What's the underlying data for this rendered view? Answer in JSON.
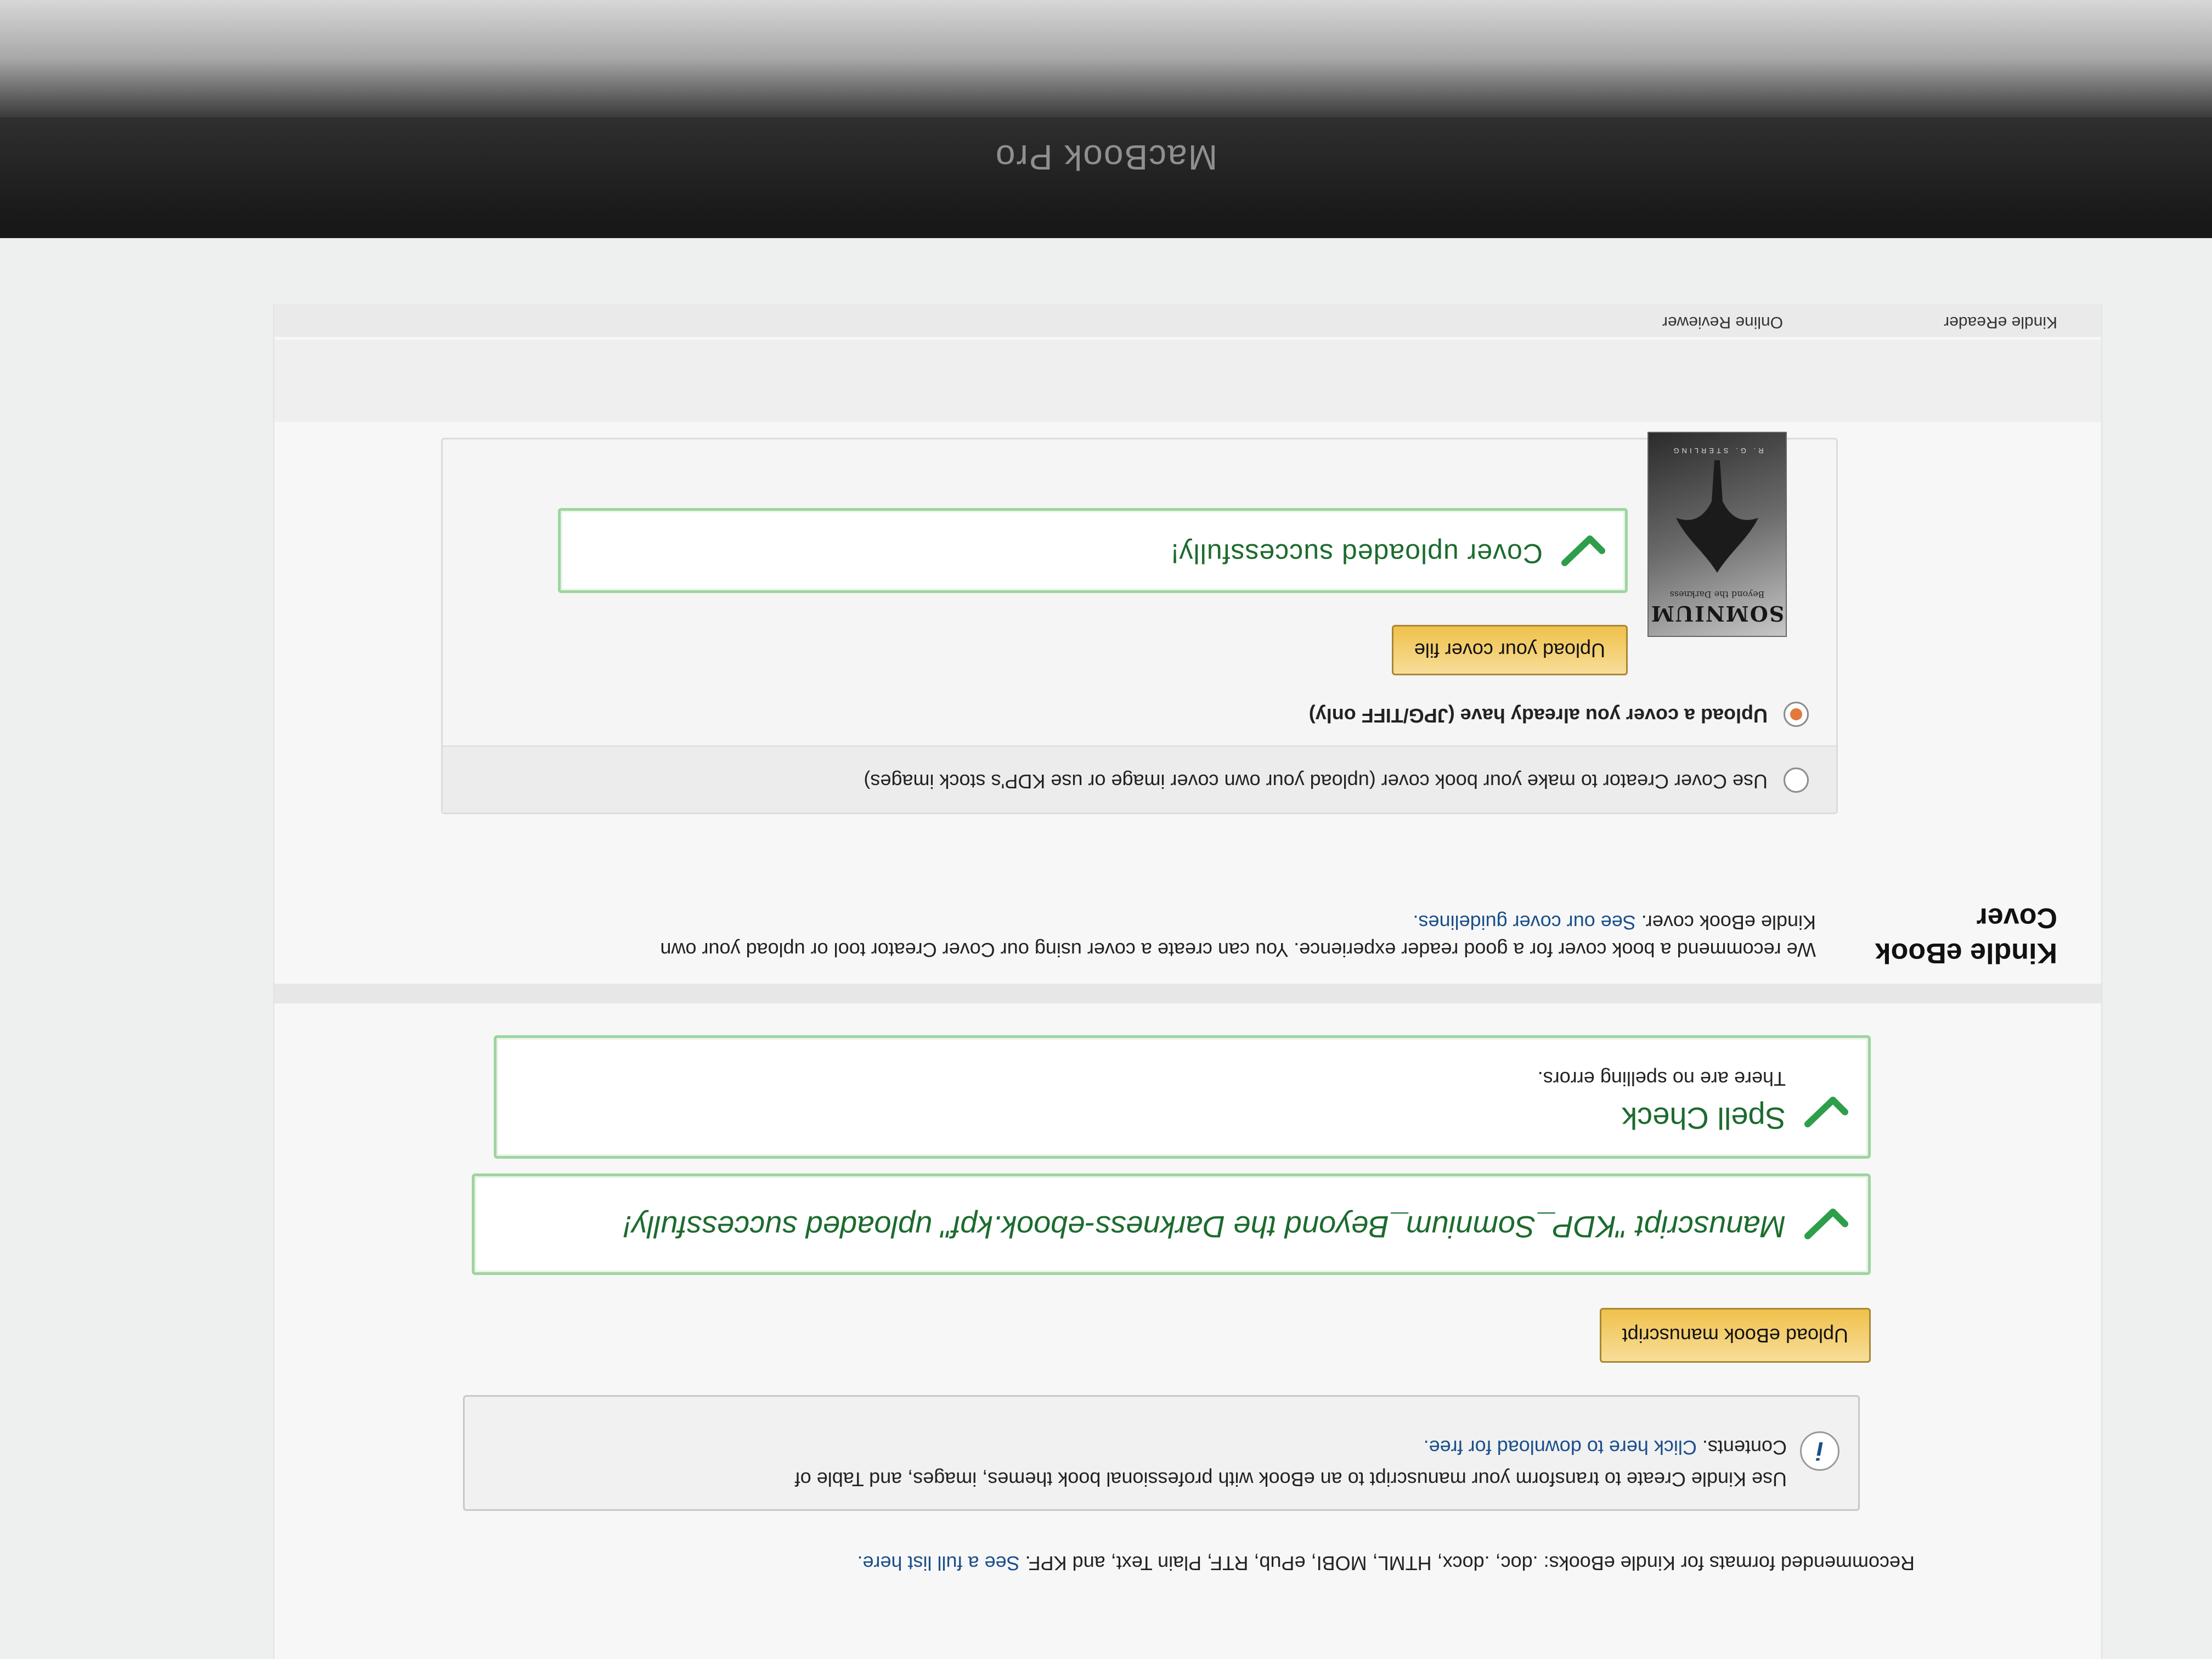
{
  "device": {
    "brand_label": "MacBook Pro"
  },
  "manuscript": {
    "formats_text": "Recommended formats for Kindle eBooks: .doc, .docx, HTML, MOBI, ePub, RTF, Plain Text, and KPF.",
    "formats_link": "See a full list here.",
    "info_icon_glyph": "i",
    "info_line1": "Use Kindle Create to transform your manuscript to an eBook with professional book themes, images, and Table of",
    "info_line2_prefix": "Contents.",
    "info_link": "Click here to download for free.",
    "upload_button_label": "Upload eBook manuscript",
    "success_message": "Manuscript \"KDP_Somnium_Beyond the Darkness-ebook.kpf\" uploaded successfully!",
    "spell_check_title": "Spell Check",
    "spell_check_detail": "There are no spelling errors."
  },
  "cover": {
    "section_title_line1": "Kindle eBook",
    "section_title_line2": "Cover",
    "description_line1": "We recommend a book cover for a good reader experience. You can create a cover using our Cover Creator tool or upload your own",
    "description_line2_prefix": "Kindle eBook cover.",
    "guidelines_link": "See our cover guidelines.",
    "option_creator_label": "Use Cover Creator to make your book cover (upload your own cover image or use KDP's stock images)",
    "option_upload_label": "Upload a cover you already have (JPG/TIFF only)",
    "selected_option": "upload",
    "upload_button_label": "Upload your cover file",
    "success_message": "Cover uploaded successfully!",
    "thumbnail": {
      "title": "SOMNIUM",
      "subtitle": "Beyond the Darkness",
      "author": "R. G. STERLING"
    }
  },
  "footer_tabs": {
    "tab1": "Online Reviewer",
    "tab2": "Kindle eReader"
  },
  "colors": {
    "accent_button": "#f0c14b",
    "success_border": "#9ed59e",
    "success_text": "#1d6b2e",
    "link": "#1a4f8a",
    "radio_selected": "#e4773b"
  }
}
